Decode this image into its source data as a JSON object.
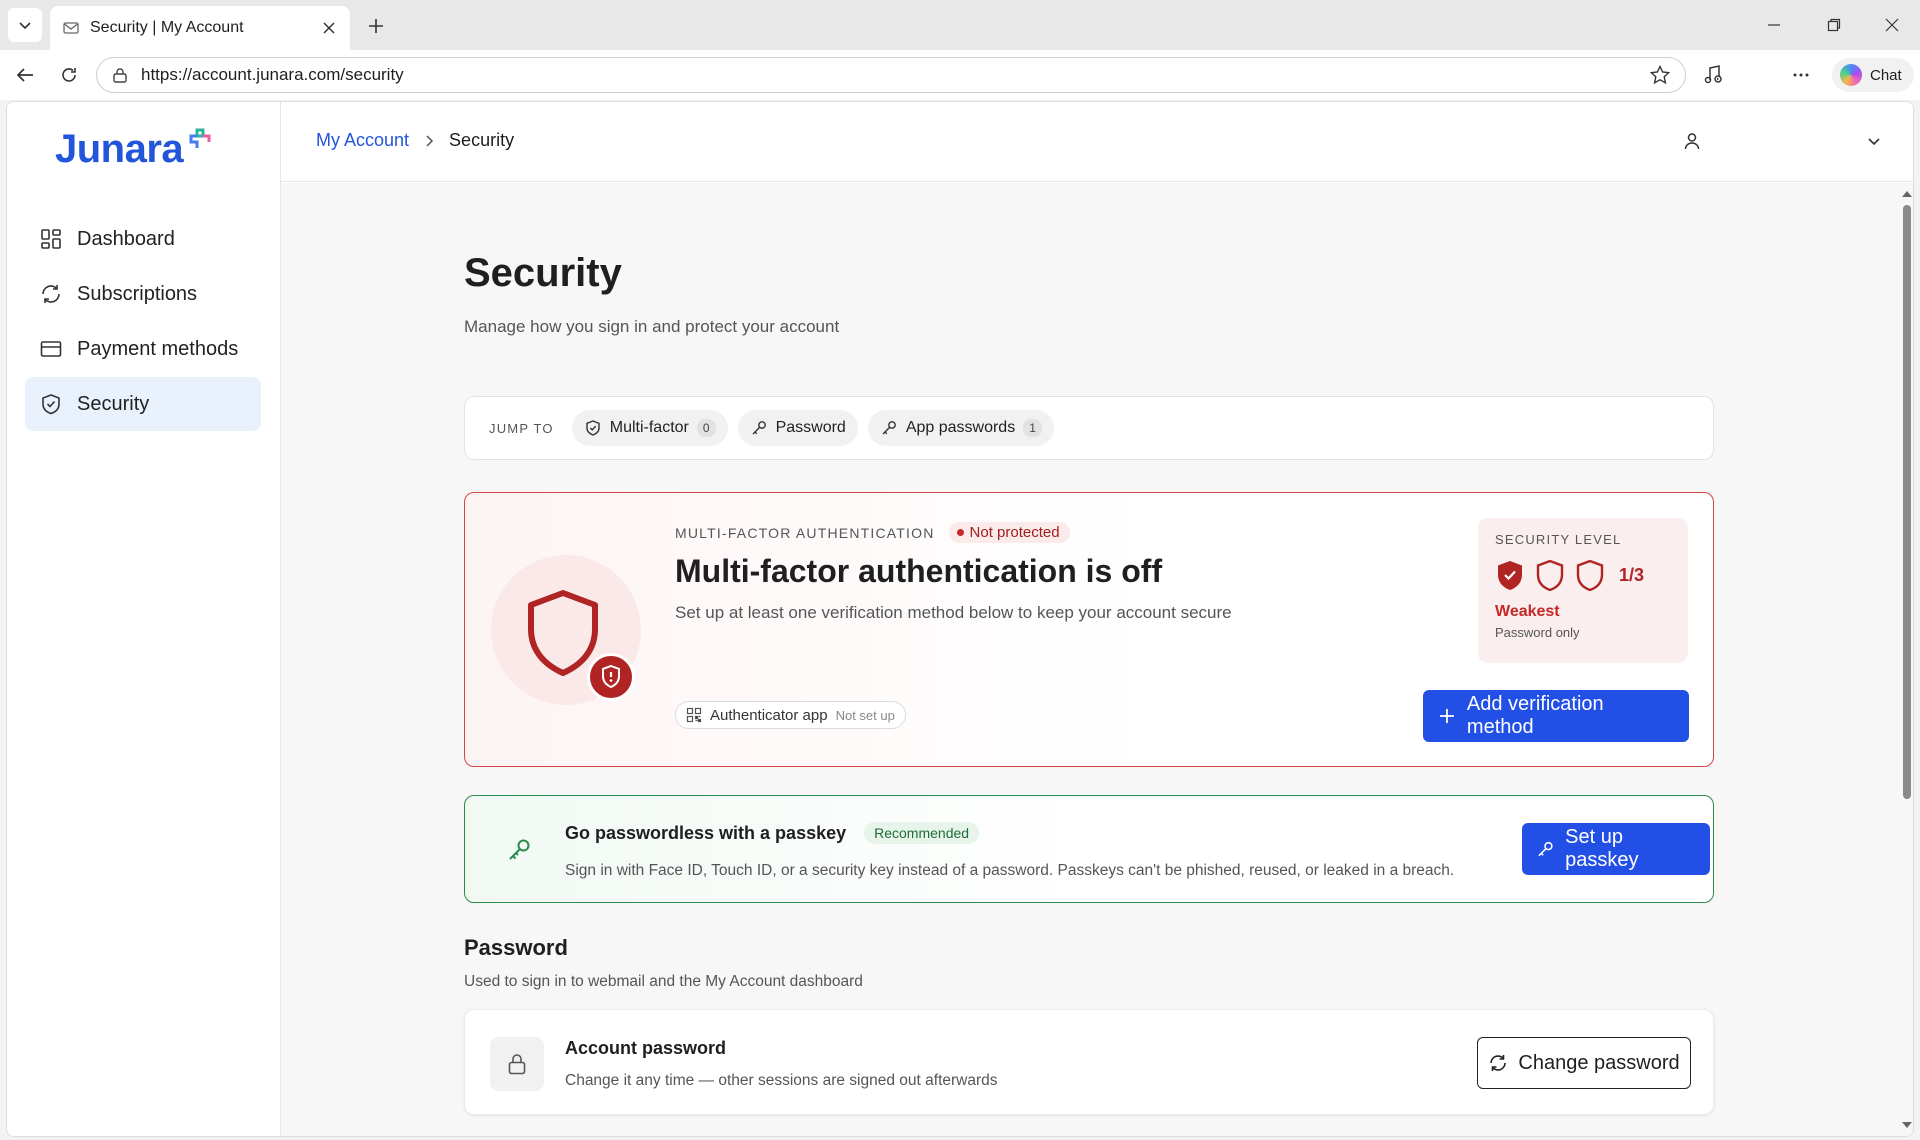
{
  "browser": {
    "tab_title": "Security | My Account",
    "url": "https://account.junara.com/security",
    "chat_label": "Chat"
  },
  "brand": {
    "name": "Junara"
  },
  "sidebar": {
    "items": [
      {
        "label": "Dashboard",
        "icon": "dashboard-icon",
        "active": false
      },
      {
        "label": "Subscriptions",
        "icon": "refresh-icon",
        "active": false
      },
      {
        "label": "Payment methods",
        "icon": "credit-card-icon",
        "active": false
      },
      {
        "label": "Security",
        "icon": "shield-check-icon",
        "active": true
      }
    ]
  },
  "breadcrumb": {
    "parent": "My Account",
    "current": "Security"
  },
  "page": {
    "title": "Security",
    "subtitle": "Manage how you sign in and protect your account"
  },
  "jump": {
    "label": "JUMP TO",
    "chips": [
      {
        "label": "Multi-factor",
        "count": "0",
        "icon": "shield-check-icon"
      },
      {
        "label": "Password",
        "icon": "key-icon"
      },
      {
        "label": "App passwords",
        "count": "1",
        "icon": "key-icon"
      }
    ]
  },
  "mfa": {
    "eyebrow": "MULTI-FACTOR AUTHENTICATION",
    "status": "Not protected",
    "title": "Multi-factor authentication is off",
    "description": "Set up at least one verification method below to keep your account secure",
    "method_name": "Authenticator app",
    "method_status": "Not set up",
    "level_label": "SECURITY LEVEL",
    "level_ratio": "1/3",
    "level_value": 1,
    "level_max": 3,
    "strength": "Weakest",
    "strength_detail": "Password only",
    "add_button": "Add verification method",
    "colors": {
      "danger": "#c62828",
      "danger_dark": "#b02424"
    }
  },
  "passkey": {
    "title": "Go passwordless with a passkey",
    "badge": "Recommended",
    "description": "Sign in with Face ID, Touch ID, or a security key instead of a password. Passkeys can't be phished, reused, or leaked in a breach.",
    "button": "Set up passkey",
    "colors": {
      "success": "#2e8b4e"
    }
  },
  "password_section": {
    "title": "Password",
    "description": "Used to sign in to webmail and the My Account dashboard",
    "card_title": "Account password",
    "card_description": "Change it any time — other sessions are signed out afterwards",
    "button": "Change password"
  },
  "theme": {
    "accent": "#2250e6",
    "link": "#2255d9"
  }
}
